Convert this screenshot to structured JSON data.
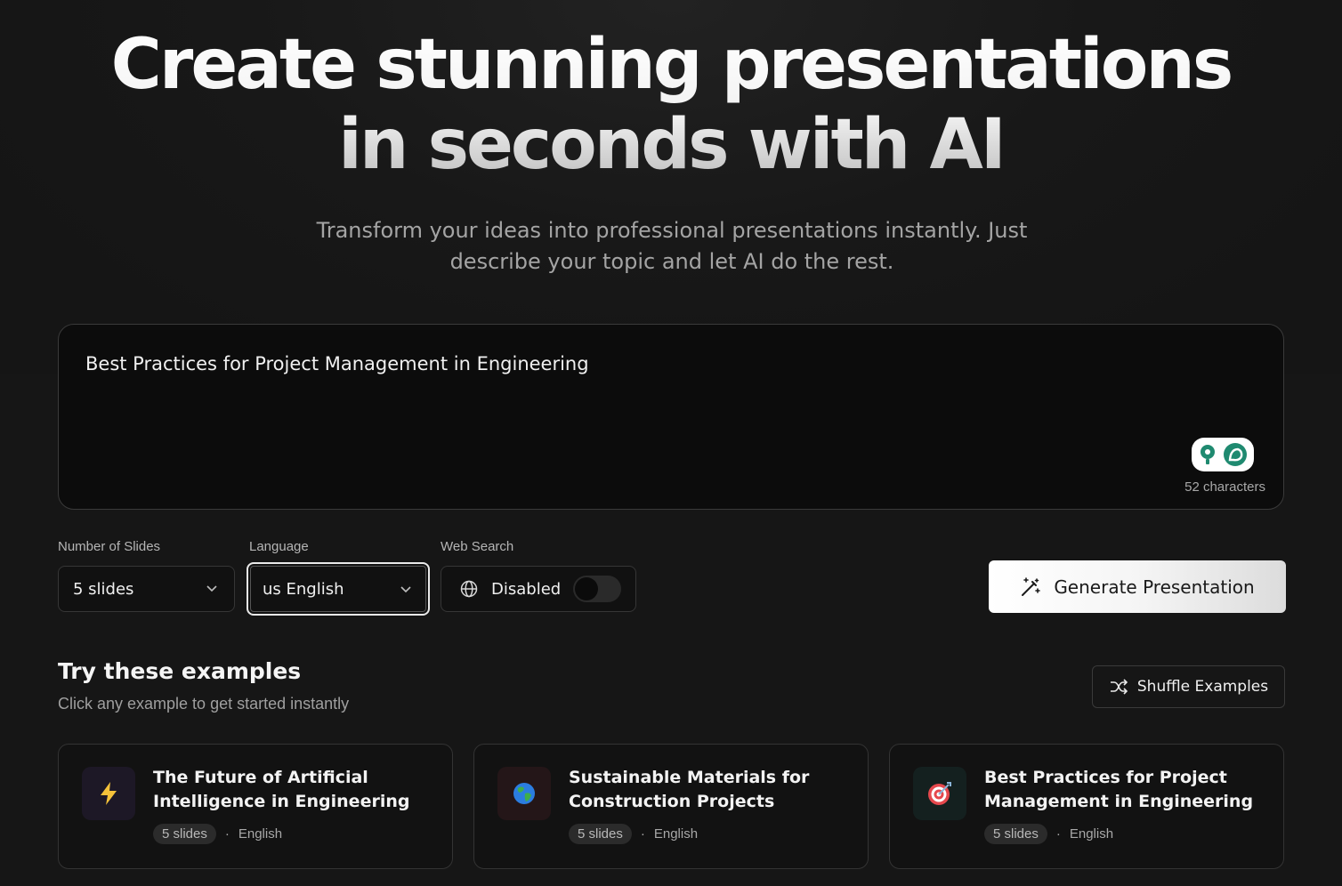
{
  "hero": {
    "title_line1": "Create stunning presentations",
    "title_line2": "in seconds with AI",
    "subtitle_line1": "Transform your ideas into professional presentations instantly. Just",
    "subtitle_line2": "describe your topic and let AI do the rest."
  },
  "prompt": {
    "value": "Best Practices for Project Management in Engineering",
    "char_count": "52 characters"
  },
  "settings": {
    "slides_label": "Number of Slides",
    "slides_value": "5 slides",
    "language_label": "Language",
    "language_value": "us English",
    "web_search_label": "Web Search",
    "web_search_value": "Disabled",
    "web_search_enabled": false
  },
  "generate_button": "Generate Presentation",
  "examples": {
    "title": "Try these examples",
    "subtitle": "Click any example to get started instantly",
    "shuffle_label": "Shuffle Examples",
    "items": [
      {
        "title": "The Future of Artificial Intelligence in Engineering",
        "slides": "5 slides",
        "separator": "·",
        "language": "English",
        "icon": "lightning-icon",
        "tile_color": "#1d1826"
      },
      {
        "title": "Sustainable Materials for Construction Projects",
        "slides": "5 slides",
        "separator": "·",
        "language": "English",
        "icon": "globe-emoji-icon",
        "tile_color": "#241618"
      },
      {
        "title": "Best Practices for Project Management in Engineering",
        "slides": "5 slides",
        "separator": "·",
        "language": "English",
        "icon": "target-icon",
        "tile_color": "#14201f"
      }
    ]
  },
  "colors": {
    "background": "#161616",
    "accent_white": "#ffffff",
    "grammar_widget_green": "#1f8a70"
  }
}
